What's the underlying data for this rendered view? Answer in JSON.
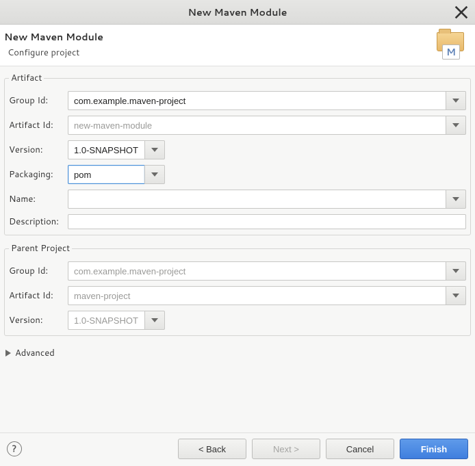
{
  "window": {
    "title": "New Maven Module"
  },
  "header": {
    "title": "New Maven Module",
    "subtitle": "Configure project",
    "badge_letter": "M"
  },
  "artifact": {
    "legend": "Artifact",
    "groupId": {
      "label": "Group Id:",
      "value": "com.example.maven-project"
    },
    "artifactId": {
      "label": "Artifact Id:",
      "value": "new-maven-module"
    },
    "version": {
      "label": "Version:",
      "value": "1.0-SNAPSHOT"
    },
    "packaging": {
      "label": "Packaging:",
      "value": "pom"
    },
    "name": {
      "label": "Name:",
      "value": ""
    },
    "description": {
      "label": "Description:",
      "value": ""
    }
  },
  "parent": {
    "legend": "Parent Project",
    "groupId": {
      "label": "Group Id:",
      "value": "com.example.maven-project"
    },
    "artifactId": {
      "label": "Artifact Id:",
      "value": "maven-project"
    },
    "version": {
      "label": "Version:",
      "value": "1.0-SNAPSHOT"
    }
  },
  "advanced": {
    "label": "Advanced",
    "expanded": false
  },
  "footer": {
    "help": "?",
    "back": "< Back",
    "next": "Next >",
    "cancel": "Cancel",
    "finish": "Finish"
  }
}
